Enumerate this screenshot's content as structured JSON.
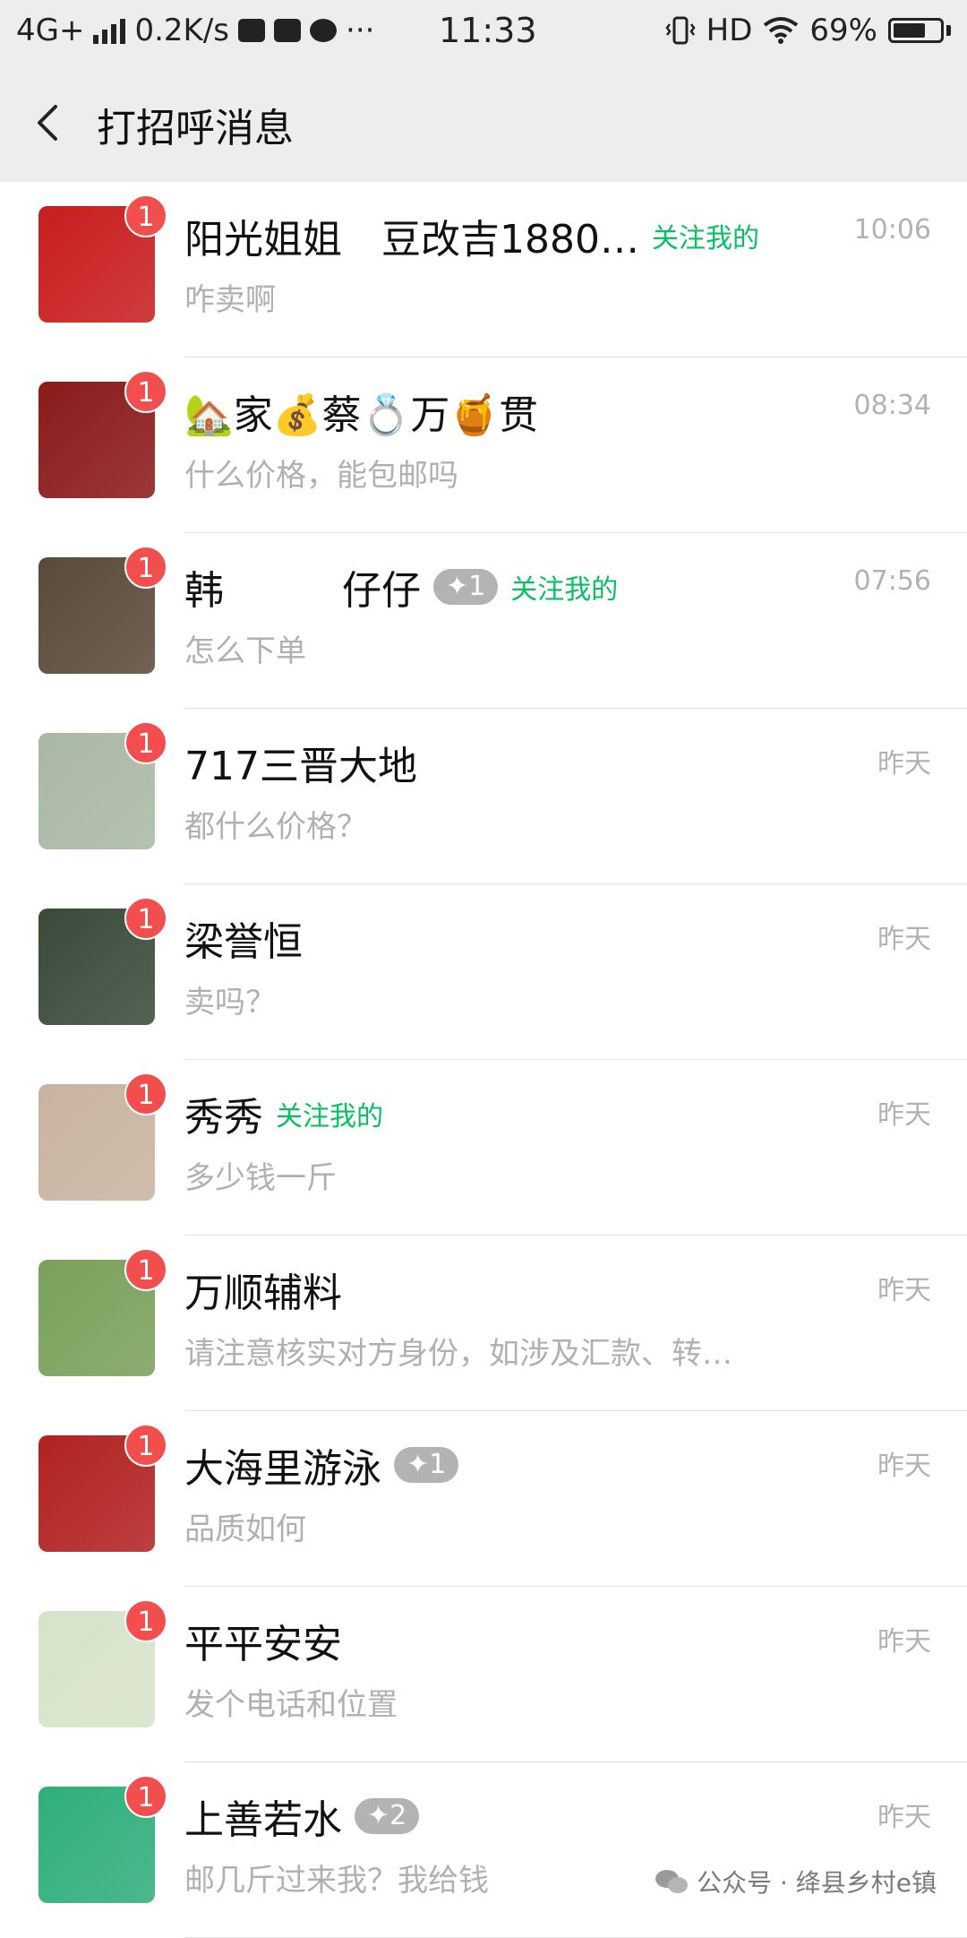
{
  "status_bar": {
    "network": "4G+",
    "speed": "0.2K/s",
    "more": "···",
    "time": "11:33",
    "hd": "HD",
    "battery": "69%",
    "battery_level": 0.69
  },
  "header": {
    "title": "打招呼消息"
  },
  "items": [
    {
      "name": "阳光姐姐　豆改吉1880…",
      "follow": "关注我的",
      "plus": "",
      "time": "10:06",
      "msg": "咋卖啊",
      "badge": "1"
    },
    {
      "name": "🏡家💰蔡💍万🍯贯",
      "follow": "",
      "plus": "",
      "time": "08:34",
      "msg": "什么价格，能包邮吗",
      "badge": "1"
    },
    {
      "name": "韩　　　仔仔",
      "follow": "关注我的",
      "plus": "✦1",
      "time": "07:56",
      "msg": "怎么下单",
      "badge": "1"
    },
    {
      "name": "717三晋大地",
      "follow": "",
      "plus": "",
      "time": "昨天",
      "msg": "都什么价格？",
      "badge": "1"
    },
    {
      "name": "梁誉恒",
      "follow": "",
      "plus": "",
      "time": "昨天",
      "msg": "卖吗？",
      "badge": "1"
    },
    {
      "name": "秀秀",
      "follow": "关注我的",
      "plus": "",
      "time": "昨天",
      "msg": "多少钱一斤",
      "badge": "1"
    },
    {
      "name": "万顺辅料",
      "follow": "",
      "plus": "",
      "time": "昨天",
      "msg": "请注意核实对方身份，如涉及汇款、转…",
      "badge": "1"
    },
    {
      "name": "大海里游泳",
      "follow": "",
      "plus": "✦1",
      "time": "昨天",
      "msg": "品质如何",
      "badge": "1"
    },
    {
      "name": "平平安安",
      "follow": "",
      "plus": "",
      "time": "昨天",
      "msg": "发个电话和位置",
      "badge": "1"
    },
    {
      "name": "上善若水",
      "follow": "",
      "plus": "✦2",
      "time": "昨天",
      "msg": "邮几斤过来我？我给钱",
      "badge": "1"
    }
  ],
  "avatar_colors": [
    "#c81e1e",
    "#8b1a1a",
    "#5a4a3a",
    "#a9b8a4",
    "#3a4a3a",
    "#c9b3a0",
    "#7aa05a",
    "#b22222",
    "#d6e3c8",
    "#2fae7a"
  ],
  "watermark": "公众号 · 绛县乡村e镇"
}
